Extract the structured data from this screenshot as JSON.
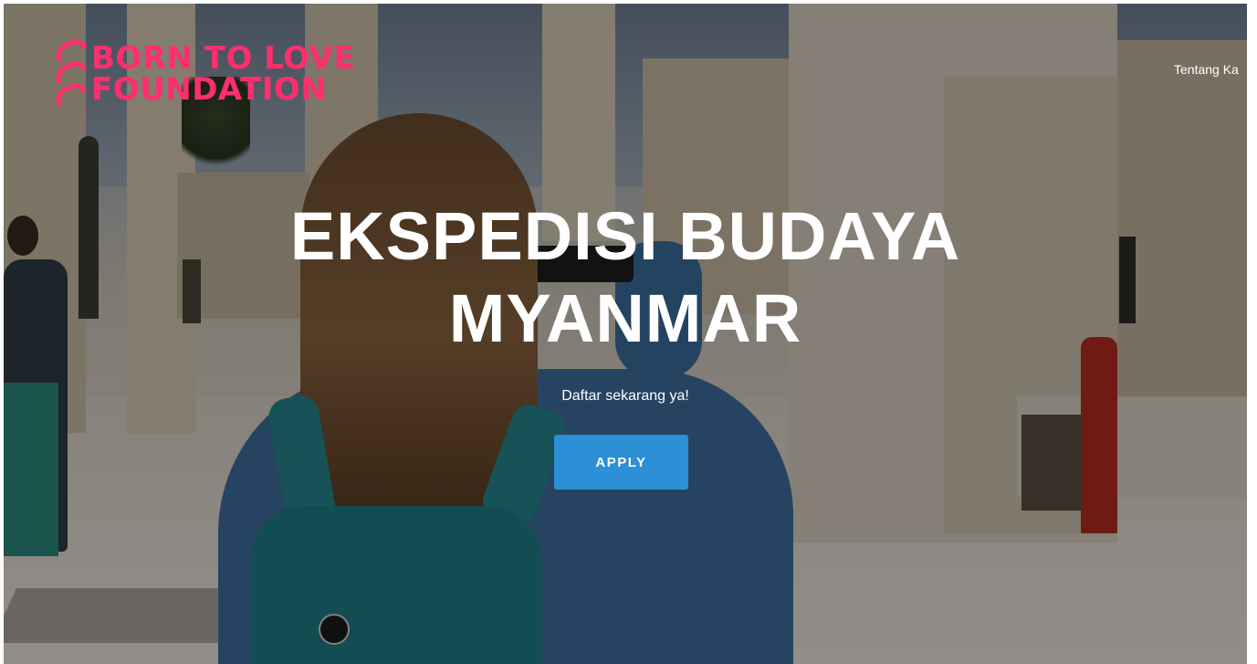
{
  "brand": {
    "name_line1": "BORN TO LOVE",
    "name_line2": "FOUNDATION",
    "color": "#ff2e6e"
  },
  "nav": {
    "items": [
      {
        "label": "Tentang Ka"
      }
    ]
  },
  "hero": {
    "title_line1": "EKSPEDISI BUDAYA",
    "title_line2": "MYANMAR",
    "subtitle": "Daftar sekarang ya!",
    "cta_label": "APPLY",
    "cta_color": "#2d8fd5",
    "background": "photo of a woman with a backpack taking a photo among stone ruins"
  }
}
